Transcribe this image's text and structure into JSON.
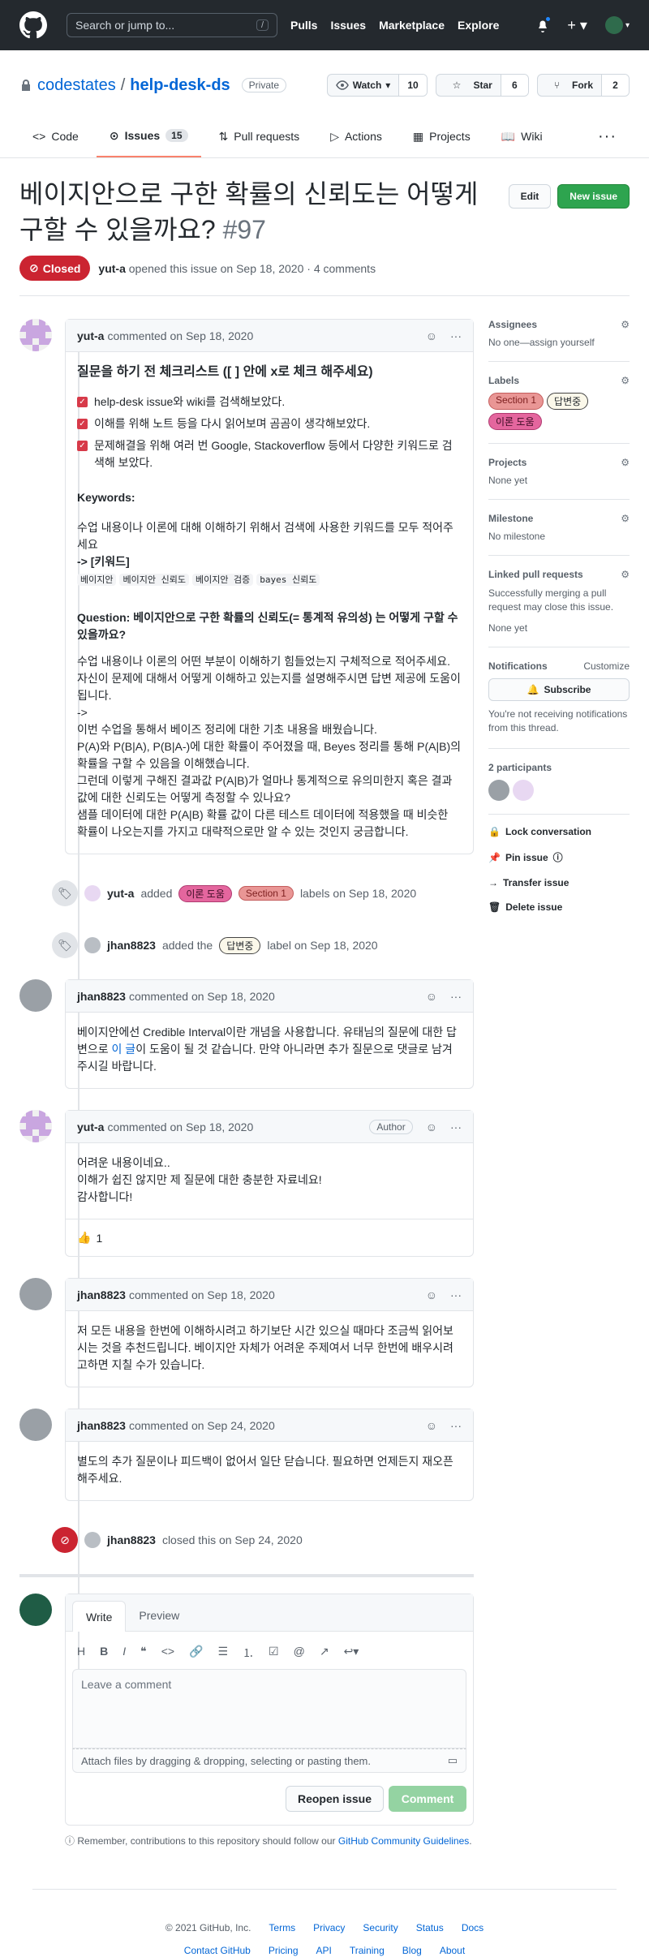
{
  "header": {
    "search_placeholder": "Search or jump to...",
    "slash": "/",
    "nav": [
      "Pulls",
      "Issues",
      "Marketplace",
      "Explore"
    ]
  },
  "repo": {
    "owner": "codestates",
    "sep": "/",
    "name": "help-desk-ds",
    "visibility": "Private",
    "watch_label": "Watch",
    "watch_count": "10",
    "star_label": "Star",
    "star_count": "6",
    "fork_label": "Fork",
    "fork_count": "2"
  },
  "tabs": [
    {
      "label": "Code"
    },
    {
      "label": "Issues",
      "count": "15"
    },
    {
      "label": "Pull requests"
    },
    {
      "label": "Actions"
    },
    {
      "label": "Projects"
    },
    {
      "label": "Wiki"
    }
  ],
  "issue": {
    "title": "베이지안으로 구한 확률의 신뢰도는 어떻게 구할 수 있을까요?",
    "number": "#97",
    "edit": "Edit",
    "new_issue": "New issue",
    "status": "Closed",
    "author": "yut-a",
    "meta": "opened this issue on Sep 18, 2020 · 4 comments"
  },
  "c1": {
    "author": "yut-a",
    "date": "commented on Sep 18, 2020",
    "heading": "질문을 하기 전 체크리스트 ([ ] 안에 x로 체크 해주세요)",
    "checks": [
      "help-desk issue와 wiki를 검색해보았다.",
      "이해를 위해 노트 등을 다시 읽어보며 곰곰이 생각해보았다.",
      "문제해결을 위해 여러 번 Google, Stackoverflow 등에서 다양한 키워드로 검색해 보았다."
    ],
    "kw_title": "Keywords:",
    "kw_desc": "수업 내용이나 이론에 대해 이해하기 위해서 검색에 사용한 키워드를 모두 적어주세요",
    "kw_arrow": "-> [키워드]",
    "keywords": [
      "베이지안",
      "베이지안 신뢰도",
      "베이지안 검증",
      "bayes 신뢰도"
    ],
    "q_title": "Question: 베이지안으로 구한 확률의 신뢰도(= 통계적 유의성) 는 어떻게 구할 수 있을까요?",
    "q_desc": "수업 내용이나 이론의 어떤 부분이 이해하기 힘들었는지 구체적으로 적어주세요. 자신이 문제에 대해서 어떻게 이해하고 있는지를 설명해주시면 답변 제공에 도움이 됩니다.",
    "lines": [
      "->",
      "이번 수업을 통해서 베이즈 정리에 대한 기초 내용을 배웠습니다.",
      "P(A)와 P(B|A), P(B|A-)에 대한 확률이 주어졌을 때, Beyes 정리를 통해 P(A|B)의 확률을 구할 수 있음을 이해했습니다.",
      "그런데 이렇게 구해진 결과값 P(A|B)가 얼마나 통계적으로 유의미한지 혹은 결과 값에 대한 신뢰도는 어떻게 측정할 수 있나요?",
      "샘플 데이터에 대한 P(A|B) 확률 값이 다른 테스트 데이터에 적용했을 때 비슷한 확률이 나오는지를 가지고 대략적으로만 알 수 있는 것인지 궁금합니다."
    ]
  },
  "ev1": {
    "user": "yut-a",
    "pre": "added",
    "label1": "이론 도움",
    "label2": "Section 1",
    "post": "labels on Sep 18, 2020"
  },
  "ev2": {
    "user": "jhan8823",
    "pre": "added the",
    "label": "답변중",
    "post": "label on Sep 18, 2020"
  },
  "c2": {
    "author": "jhan8823",
    "date": "commented on Sep 18, 2020",
    "text1": "베이지안에선 Credible Interval이란 개념을 사용합니다. 유태님의 질문에 대한 답변으로 ",
    "link": "이 글",
    "text2": "이 도움이 될 것 같습니다. 만약 아니라면 추가 질문으로 댓글로 남겨주시길 바랍니다."
  },
  "c3": {
    "author": "yut-a",
    "date": "commented on Sep 18, 2020",
    "badge": "Author",
    "lines": [
      "어려운 내용이네요..",
      "이해가 쉽진 않지만 제 질문에 대한 충분한 자료네요!",
      "감사합니다!"
    ],
    "reaction_emoji": "👍",
    "reaction_count": "1"
  },
  "c4": {
    "author": "jhan8823",
    "date": "commented on Sep 18, 2020",
    "text": "저 모든 내용을 한번에 이해하시려고 하기보단 시간 있으실 때마다 조금씩 읽어보시는 것을 추천드립니다. 베이지안 자체가 어려운 주제여서 너무 한번에 배우시려고하면 지칠 수가 있습니다."
  },
  "c5": {
    "author": "jhan8823",
    "date": "commented on Sep 24, 2020",
    "text": "별도의 추가 질문이나 피드백이 없어서 일단 닫습니다. 필요하면 언제든지 재오픈 해주세요."
  },
  "ev3": {
    "user": "jhan8823",
    "post": "closed this on Sep 24, 2020"
  },
  "composer": {
    "write": "Write",
    "preview": "Preview",
    "placeholder": "Leave a comment",
    "attach": "Attach files by dragging & dropping, selecting or pasting them.",
    "reopen": "Reopen issue",
    "comment": "Comment",
    "tip": "Remember, contributions to this repository should follow our ",
    "tip_link": "GitHub Community Guidelines",
    "tip_end": "."
  },
  "sidebar": {
    "assignees": "Assignees",
    "assignees_val": "No one—assign yourself",
    "labels": "Labels",
    "labels_list": [
      "Section 1",
      "답변중",
      "이론 도움"
    ],
    "projects": "Projects",
    "projects_val": "None yet",
    "milestone": "Milestone",
    "milestone_val": "No milestone",
    "linked": "Linked pull requests",
    "linked_desc": "Successfully merging a pull request may close this issue.",
    "linked_val": "None yet",
    "notifications": "Notifications",
    "customize": "Customize",
    "subscribe": "Subscribe",
    "notif_desc": "You're not receiving notifications from this thread.",
    "participants": "2 participants",
    "lock": "Lock conversation",
    "pin": "Pin issue",
    "transfer": "Transfer issue",
    "delete": "Delete issue"
  },
  "footer": {
    "copyright": "© 2021 GitHub, Inc.",
    "row1": [
      "Terms",
      "Privacy",
      "Security",
      "Status",
      "Docs"
    ],
    "row2": [
      "Contact GitHub",
      "Pricing",
      "API",
      "Training",
      "Blog",
      "About"
    ]
  }
}
